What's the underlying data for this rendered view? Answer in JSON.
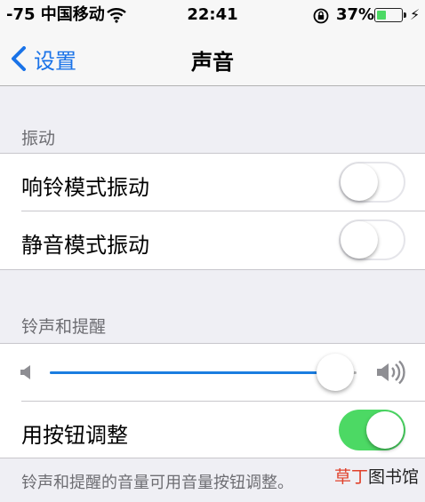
{
  "status_bar": {
    "signal_text": "-75 中国移动",
    "wifi_icon": "wifi-icon",
    "time": "22:41",
    "lock_icon": "rotation-lock-icon",
    "battery_percent": "37%",
    "battery_level": 0.37,
    "charging_icon": "charging-bolt-icon"
  },
  "nav": {
    "back_label": "设置",
    "title": "声音"
  },
  "vibrate_section": {
    "header": "振动",
    "rows": [
      {
        "label": "响铃模式振动",
        "on": false
      },
      {
        "label": "静音模式振动",
        "on": false
      }
    ]
  },
  "ringer_section": {
    "header": "铃声和提醒",
    "volume_level": 0.93,
    "button_adjust": {
      "label": "用按钮调整",
      "on": true
    },
    "footer": "铃声和提醒的音量可用音量按钮调整。"
  },
  "watermark": {
    "text_accent": "草丁",
    "text_rest": "图书馆"
  },
  "colors": {
    "accent": "#1a73e8",
    "toggle_on": "#4cd964",
    "battery": "#4cd964"
  }
}
